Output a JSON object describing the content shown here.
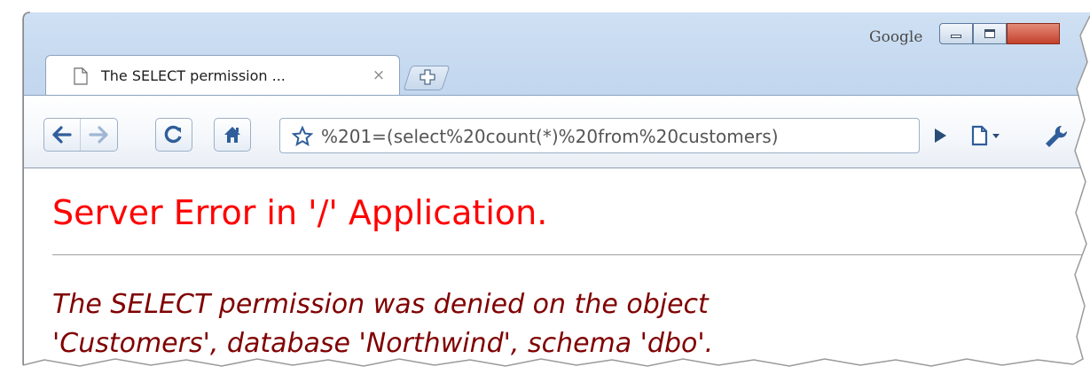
{
  "window": {
    "brand_label": "Google"
  },
  "tabs": [
    {
      "title": "The SELECT permission ...",
      "close_glyph": "×",
      "icon": "page-icon"
    }
  ],
  "toolbar": {
    "url": "%201=(select%20count(*)%20from%20customers)",
    "icons": [
      "back-arrow-icon",
      "forward-arrow-icon",
      "reload-icon",
      "home-icon",
      "star-icon",
      "go-arrow-icon",
      "page-menu-icon",
      "wrench-icon"
    ]
  },
  "page": {
    "heading": "Server Error in '/' Application.",
    "message_line1": "The SELECT permission was denied on the object",
    "message_line2": "'Customers', database 'Northwind', schema 'dbo'."
  },
  "colors": {
    "heading": "#ff0000",
    "message": "#800000",
    "frame": "#c4d8ef"
  }
}
